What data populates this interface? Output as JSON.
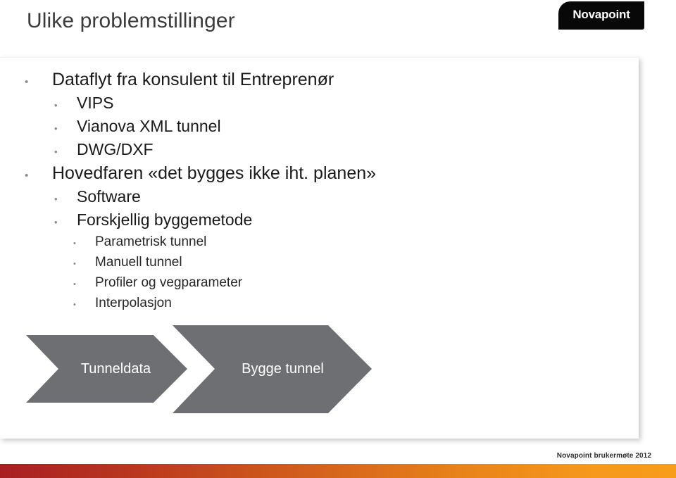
{
  "slide": {
    "title": "Ulike problemstillinger"
  },
  "logo": {
    "name": "Novapoint",
    "background_color": "#080808",
    "text_color": "#ffffff"
  },
  "bullets": [
    {
      "level": 1,
      "text": "Dataflyt fra konsulent til Entreprenør",
      "marker": "•"
    },
    {
      "level": 2,
      "text": "VIPS",
      "marker": "•"
    },
    {
      "level": 2,
      "text": "Vianova XML tunnel",
      "marker": "•"
    },
    {
      "level": 2,
      "text": "DWG/DXF",
      "marker": "•"
    },
    {
      "level": 1,
      "text": "Hovedfaren «det bygges ikke iht. planen»",
      "marker": "•"
    },
    {
      "level": 2,
      "text": "Software",
      "marker": "•"
    },
    {
      "level": 2,
      "text": "Forskjellig byggemetode",
      "marker": "•"
    },
    {
      "level": 3,
      "text": "Parametrisk tunnel",
      "marker": "•"
    },
    {
      "level": 3,
      "text": "Manuell tunnel",
      "marker": "•"
    },
    {
      "level": 3,
      "text": "Profiler og vegparameter",
      "marker": "•"
    },
    {
      "level": 3,
      "text": "Interpolasjon",
      "marker": "•"
    }
  ],
  "process": {
    "shape_color": "#6e6f73",
    "label_color": "#ffffff",
    "steps": [
      {
        "label": "Tunneldata"
      },
      {
        "label": "Bygge tunnel"
      }
    ]
  },
  "footer": {
    "note": "Novapoint brukermøte 2012",
    "bar_color_left": "#a81f22",
    "bar_color_right": "#f89c1c"
  },
  "colors": {
    "title": "#3b3b3b",
    "body_text": "#1a1a1a",
    "bullet_marker": "#8a8a8a",
    "panel_background": "#ffffff"
  }
}
